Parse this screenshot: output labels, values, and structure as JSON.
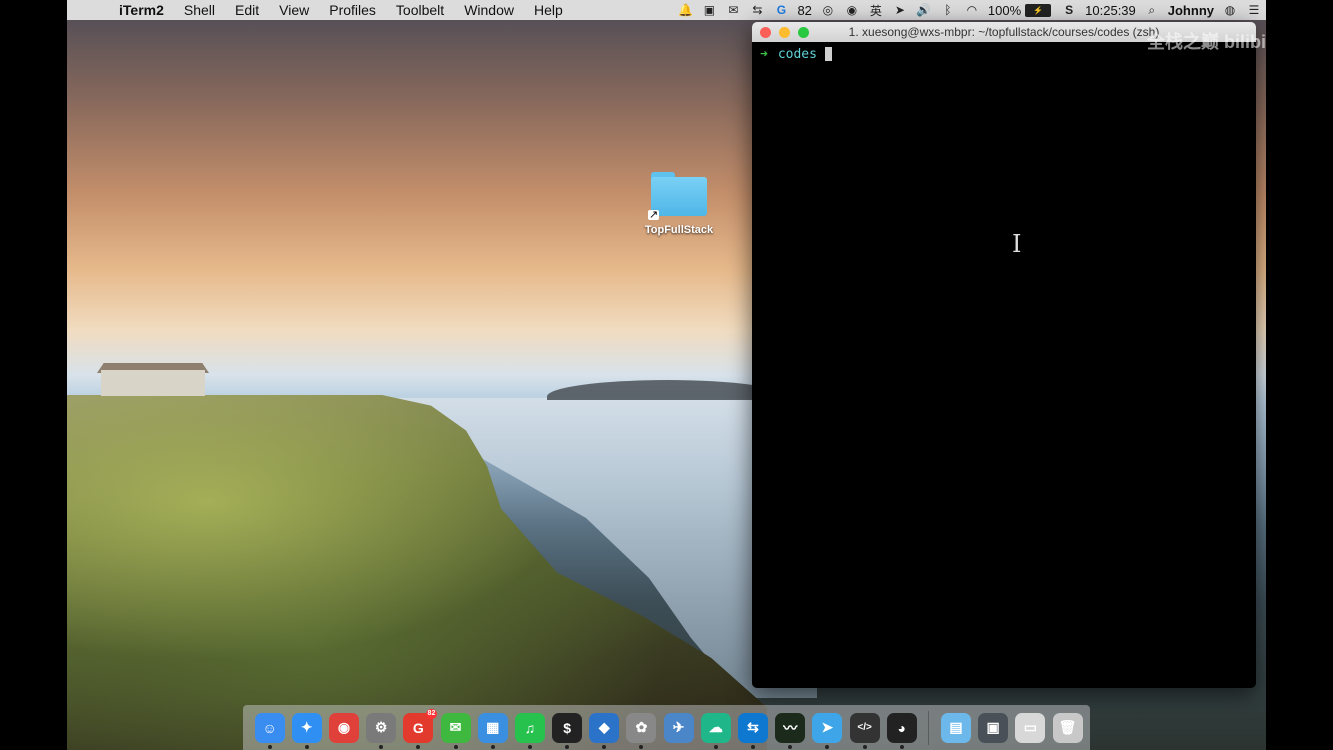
{
  "menubar": {
    "apple_icon": "apple-logo-icon",
    "app_name": "iTerm2",
    "menus": [
      "Shell",
      "Edit",
      "View",
      "Profiles",
      "Toolbelt",
      "Window",
      "Help"
    ],
    "status": {
      "badge_count": "82",
      "battery_percent": "100%",
      "clock": "10:25:39",
      "user": "Johnny"
    }
  },
  "desktop": {
    "folder_label": "TopFullStack"
  },
  "terminal": {
    "title": "1. xuesong@wxs-mbpr: ~/topfullstack/courses/codes (zsh)",
    "prompt_arrow": "➜",
    "prompt_dir": "codes"
  },
  "watermark": "全栈之巅 bilibili",
  "dock": {
    "badge_count": "82",
    "apps": [
      {
        "name": "finder-icon",
        "glyph": "☺",
        "color": "#3a8df0"
      },
      {
        "name": "safari-icon",
        "glyph": "✦",
        "color": "#2f8ff2"
      },
      {
        "name": "chrome-icon",
        "glyph": "◉",
        "color": "#e0403a"
      },
      {
        "name": "system-preferences-icon",
        "glyph": "⚙",
        "color": "#7a7a7a"
      },
      {
        "name": "weibo-icon",
        "glyph": "G",
        "color": "#e23b2e"
      },
      {
        "name": "wechat-icon",
        "glyph": "✉",
        "color": "#3fb83f"
      },
      {
        "name": "folder-app-icon",
        "glyph": "▦",
        "color": "#3b8fe0"
      },
      {
        "name": "music-icon",
        "glyph": "♫",
        "color": "#27c24d"
      },
      {
        "name": "terminal-icon",
        "glyph": "$",
        "color": "#222"
      },
      {
        "name": "vscode-icon",
        "glyph": "◆",
        "color": "#2a73c9"
      },
      {
        "name": "photo-app-icon",
        "glyph": "✿",
        "color": "#888"
      },
      {
        "name": "xcode-icon",
        "glyph": "✈",
        "color": "#4a86c8"
      },
      {
        "name": "cloud-icon",
        "glyph": "☁",
        "color": "#1fb78a"
      },
      {
        "name": "teamviewer-icon",
        "glyph": "⇆",
        "color": "#0e77d0"
      },
      {
        "name": "activity-monitor-icon",
        "glyph": "〰",
        "color": "#1c2a1c"
      },
      {
        "name": "paper-plane-icon",
        "glyph": "➤",
        "color": "#3ea6e8"
      },
      {
        "name": "code-editor-icon",
        "glyph": "</>",
        "color": "#333"
      },
      {
        "name": "qq-icon",
        "glyph": "◕",
        "color": "#222"
      }
    ],
    "stack_items": [
      {
        "name": "downloads-folder-icon",
        "glyph": "▤",
        "color": "#6cb8ea"
      },
      {
        "name": "screenshot-stack-icon",
        "glyph": "▣",
        "color": "#4a5058"
      },
      {
        "name": "windows-stack-icon",
        "glyph": "▭",
        "color": "#d8d8d8"
      },
      {
        "name": "trash-icon",
        "glyph": "🗑",
        "color": "#c8c8c8"
      }
    ]
  }
}
